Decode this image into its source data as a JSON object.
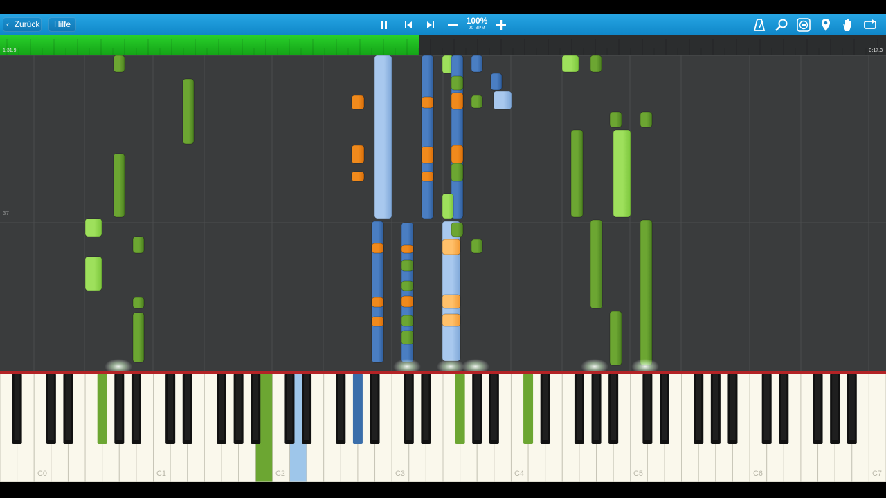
{
  "toolbar": {
    "back_label": "Zurück",
    "help_label": "Hilfe",
    "icons": {
      "pause": "pause-icon",
      "previous": "skip-previous-icon",
      "next": "skip-next-icon",
      "slower": "minus-icon",
      "faster": "plus-icon",
      "metronome": "metronome-icon",
      "zoom": "magnifier-icon",
      "note_labels": "note-label-icon",
      "bookmark": "location-pin-icon",
      "hands": "hand-icon",
      "loop": "loop-icon"
    },
    "speed_percent": "100%",
    "speed_bpm": "90 BPM"
  },
  "progress": {
    "elapsed": "1:31.9",
    "total": "3:17.3",
    "fraction": 0.473
  },
  "measure_label": "37",
  "keyboard": {
    "octave_labels": [
      "C0",
      "C1",
      "C2",
      "C3",
      "C4",
      "C5",
      "C6",
      "C7"
    ],
    "pressed_keys": [
      {
        "key": "F#1",
        "color": "#6ca632"
      },
      {
        "key": "B2",
        "color": "#6ca632"
      },
      {
        "key": "D3",
        "color": "#9ec6ea"
      },
      {
        "key": "G#3",
        "color": "#3a6eaa"
      },
      {
        "key": "F#4",
        "color": "#6ca632"
      },
      {
        "key": "C#5",
        "color": "#6ca632"
      }
    ]
  },
  "colors": {
    "toolbar": "#1a96d8",
    "progress_fill": "#1fbf22",
    "background": "#3a3c3d",
    "green_track": "#6ca632",
    "light_green_track": "#9ee05c",
    "blue_track": "#4a7ec2",
    "light_blue_track": "#a8c8ee",
    "orange_track": "#f08a1c",
    "light_orange_track": "#ffc06a"
  }
}
